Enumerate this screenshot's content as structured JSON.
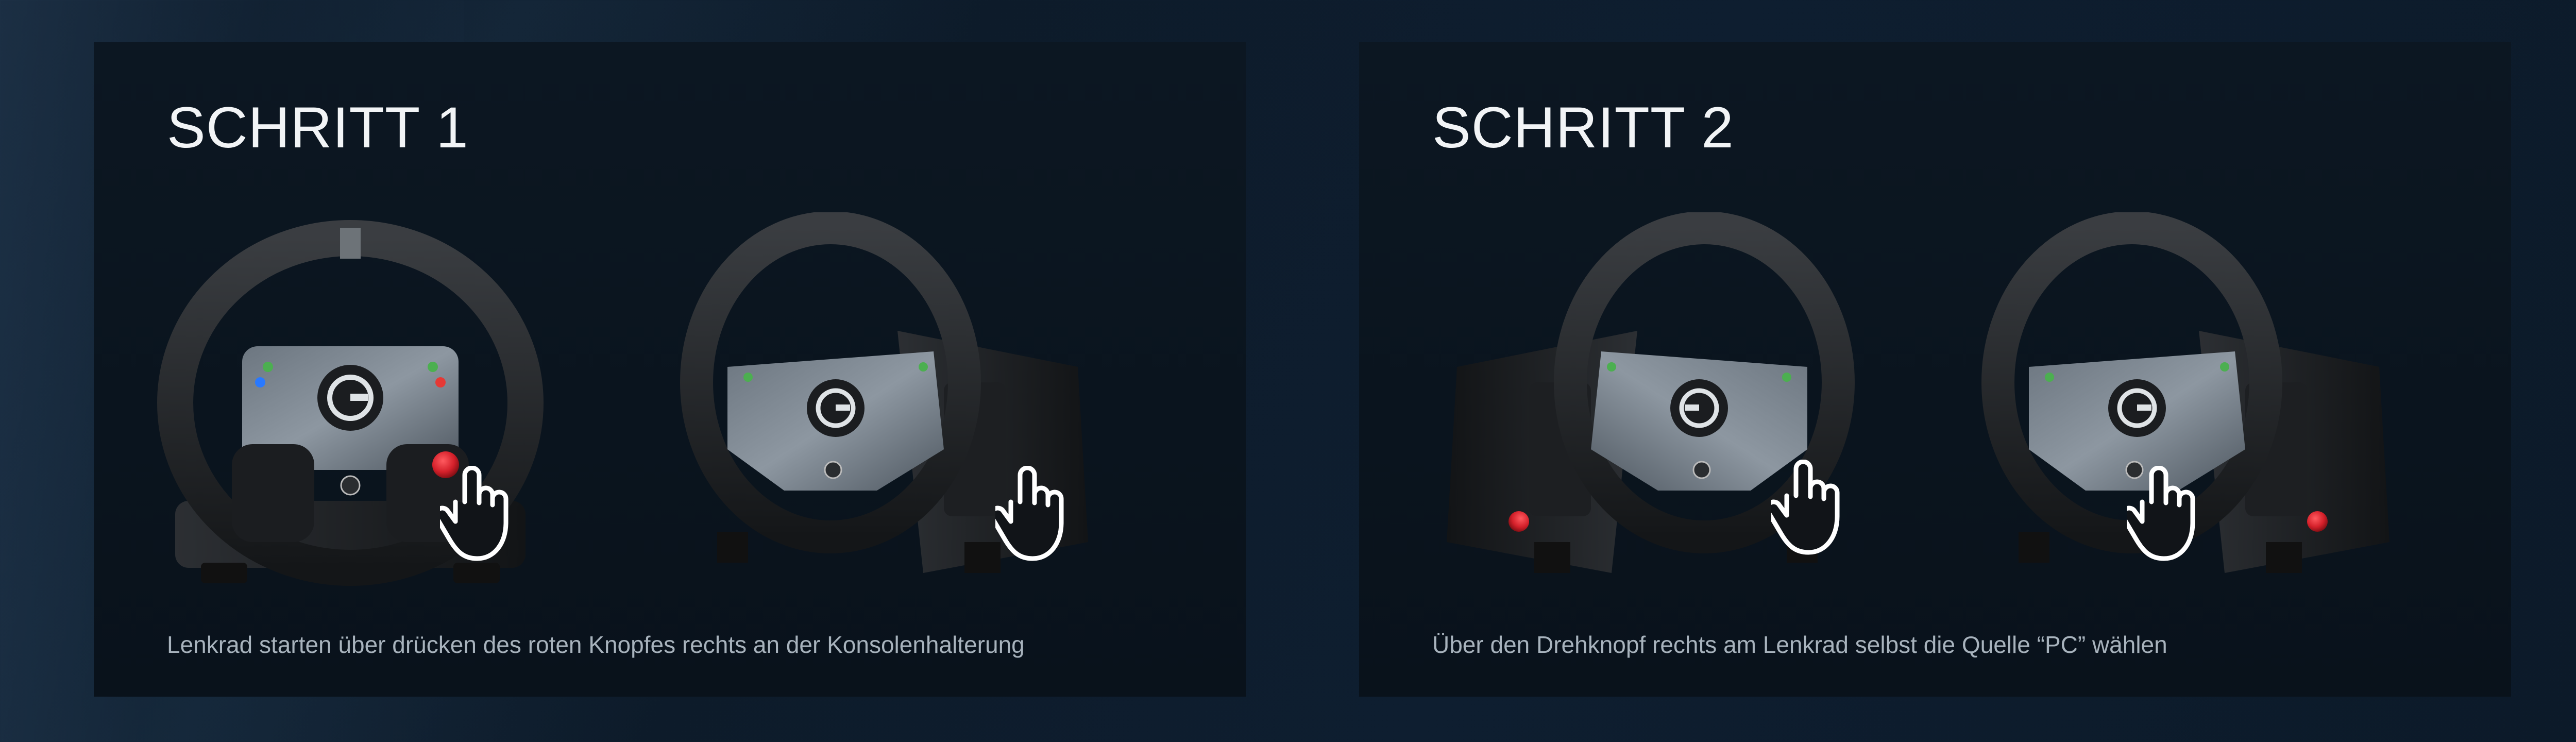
{
  "steps": [
    {
      "title": "SCHRITT 1",
      "caption": "Lenkrad starten über drücken des roten Knopfes rechts an der Konsolenhalterung"
    },
    {
      "title": "SCHRITT 2",
      "caption": "Über den Drehknopf rechts am Lenkrad selbst die Quelle “PC” wählen"
    }
  ],
  "colors": {
    "background": "#0d1b2a",
    "panel": "#0b1520",
    "title_text": "#f2f4f6",
    "caption_text": "#a8b3bd",
    "button_red": "#d4202a",
    "hand_icon": "#ffffff"
  },
  "icons": [
    "logitech-g-logo",
    "xbox-logo",
    "tap-hand-icon"
  ]
}
